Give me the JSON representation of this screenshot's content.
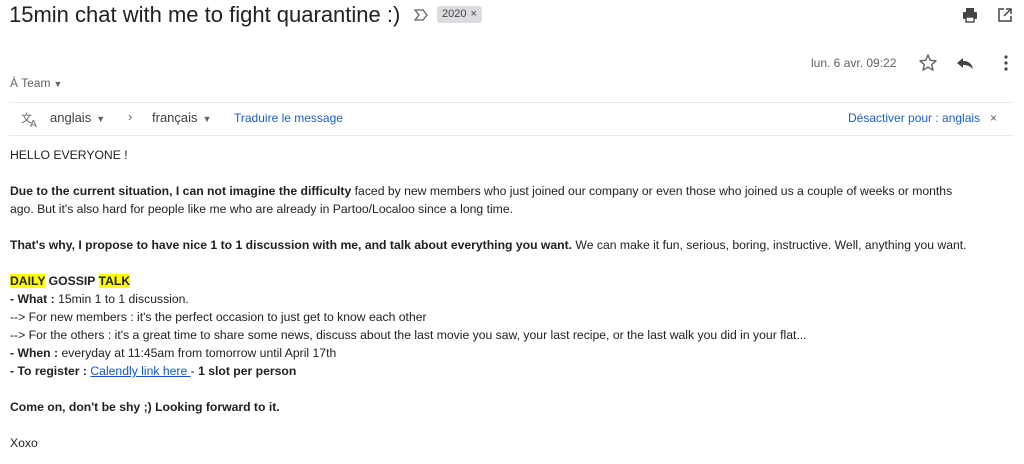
{
  "subject": {
    "title": "15min chat with me to fight quarantine :)",
    "label": "2020",
    "label_close": "×"
  },
  "header": {
    "recipient": "À Team",
    "date": "lun. 6 avr. 09:22"
  },
  "translate": {
    "from_lang": "anglais",
    "to_lang": "français",
    "translate_link": "Traduire le message",
    "disable_link": "Désactiver pour : anglais",
    "close": "×"
  },
  "icons": {
    "important": "important-marker-icon",
    "print": "print-icon",
    "new_window": "open-in-new-window-icon",
    "star": "star-icon",
    "reply": "reply-icon",
    "more": "more-vertical-icon",
    "translate": "translate-icon"
  },
  "colors": {
    "highlight": "#ffff00",
    "link": "#1155cc"
  },
  "message": {
    "greeting": "HELLO EVERYONE !",
    "p1_bold": "Due to the current situation, I can not imagine the difficulty",
    "p1_rest": " faced by new members who just joined our company or even those who joined us a couple of weeks or months",
    "p1_line2": "ago. But it's also hard for people like me who are already in Partoo/Localoo since a long time.",
    "p2_bold": "That's why, I propose to have nice 1 to 1 discussion with me, and talk about everything you want.",
    "p2_rest": " We can make it fun, serious, boring, instructive. Well, anything you want.",
    "section_daily": "DAILY",
    "section_gossip": " GOSSIP ",
    "section_talk": "TALK",
    "what_label": "- What :",
    "what_value": " 15min 1 to 1 discussion.",
    "new_members": "--> For new members : it's the perfect occasion to just get to know each other",
    "others": "--> For the others : it's a great time to share some news, discuss about the last movie you saw, your last recipe, or the last walk you did in your flat...",
    "when_label": "- When :",
    "when_value": " everyday at 11:45am from tomorrow until April 17th",
    "register_label": "- To register :",
    "register_link": "Calendly link here ",
    "register_sep": "- ",
    "register_bold": "1 slot per person",
    "come_on": "Come on, don't be shy ;) Looking forward to it.",
    "signoff": "Xoxo"
  }
}
